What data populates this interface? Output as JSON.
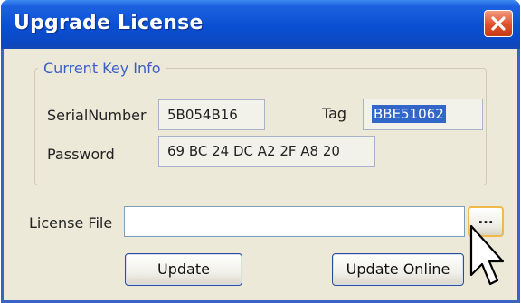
{
  "window": {
    "title": "Upgrade License"
  },
  "key_info": {
    "legend": "Current Key Info",
    "serial_label": "SerialNumber",
    "serial_value": "5B054B16",
    "tag_label": "Tag",
    "tag_value": "BBE51062",
    "password_label": "Password",
    "password_value": "69 BC 24 DC A2 2F A8 20"
  },
  "license": {
    "label": "License File",
    "value": "",
    "browse_label": "..."
  },
  "buttons": {
    "update": "Update",
    "update_online": "Update Online"
  },
  "icons": {
    "close": "close-icon",
    "cursor": "mouse-pointer-icon"
  },
  "colors": {
    "titlebar": "#0a4fd3",
    "close": "#e0512a",
    "legend": "#3c5ec6",
    "selection": "#3267c9"
  }
}
